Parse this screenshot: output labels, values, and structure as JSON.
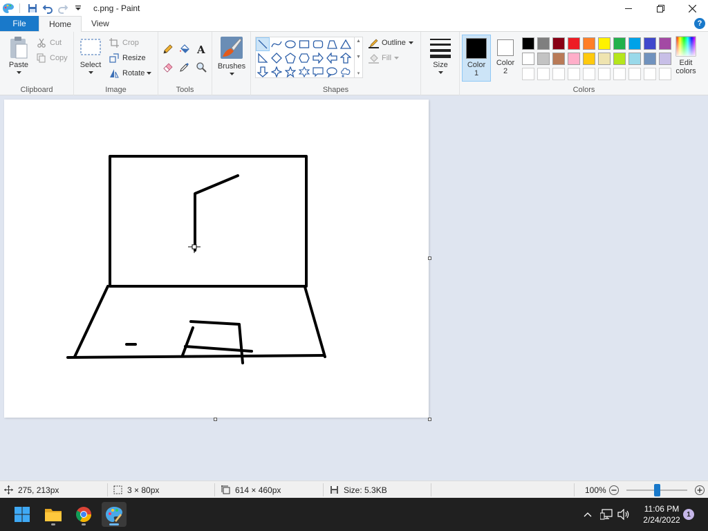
{
  "window": {
    "title": "c.png - Paint"
  },
  "tabs": {
    "file": "File",
    "home": "Home",
    "view": "View",
    "help": "?"
  },
  "clipboard": {
    "paste": "Paste",
    "cut": "Cut",
    "copy": "Copy",
    "label": "Clipboard"
  },
  "image": {
    "select": "Select",
    "crop": "Crop",
    "resize": "Resize",
    "rotate": "Rotate",
    "label": "Image"
  },
  "tools": {
    "label": "Tools"
  },
  "brushes": {
    "label": "Brushes"
  },
  "shapes": {
    "outline": "Outline",
    "fill": "Fill",
    "label": "Shapes"
  },
  "size": {
    "label": "Size"
  },
  "colors": {
    "color1_line1": "Color",
    "color1_line2": "1",
    "color2_line1": "Color",
    "color2_line2": "2",
    "color1": "#000000",
    "color2": "#ffffff",
    "edit_line1": "Edit",
    "edit_line2": "colors",
    "label": "Colors",
    "palette_row1": [
      "#000000",
      "#7f7f7f",
      "#880015",
      "#ed1c24",
      "#ff7f27",
      "#fff200",
      "#22b14c",
      "#00a2e8",
      "#3f48cc",
      "#a349a4"
    ],
    "palette_row2": [
      "#ffffff",
      "#c3c3c3",
      "#b97a57",
      "#ffaec9",
      "#ffc90e",
      "#efe4b0",
      "#b5e61d",
      "#99d9ea",
      "#7092be",
      "#c8bfe7"
    ],
    "palette_row3": [
      "#ffffff",
      "#ffffff",
      "#ffffff",
      "#ffffff",
      "#ffffff",
      "#ffffff",
      "#ffffff",
      "#ffffff",
      "#ffffff",
      "#ffffff"
    ]
  },
  "status": {
    "cursor_pos": "275, 213px",
    "selection_size": "3 × 80px",
    "image_size": "614 × 460px",
    "file_size": "Size: 5.3KB",
    "zoom": "100%",
    "zoom_fraction": 0.5
  },
  "taskbar": {
    "time": "11:06 PM",
    "date": "2/24/2022",
    "notifications": "1"
  }
}
